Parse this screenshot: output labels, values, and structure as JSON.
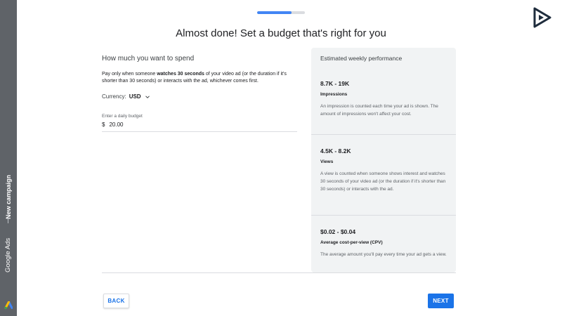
{
  "sidebar": {
    "brand": "Google Ads",
    "campaign": "New campaign"
  },
  "progress": {
    "fraction": 0.72
  },
  "title": "Almost done! Set a budget that's right for you",
  "spend": {
    "heading": "How much you want to spend",
    "desc_before": "Pay only when someone ",
    "desc_bold": "watches 30 seconds",
    "desc_after": " of your video ad (or the duration if it's shorter than 30 seconds) or interacts with the ad, whichever comes first.",
    "currency_label": "Currency:",
    "currency_value": "USD",
    "budget_label": "Enter a daily budget",
    "budget_symbol": "$",
    "budget_value": "20.00"
  },
  "performance": {
    "heading": "Estimated weekly performance",
    "metrics": [
      {
        "range": "8.7K - 19K",
        "name": "Impressions",
        "desc": "An impression is counted each time your ad is shown. The amount of impressions won't affect your cost."
      },
      {
        "range": "4.5K - 8.2K",
        "name": "Views",
        "desc": "A view is counted when someone shows interest and watches 30 seconds of your video ad (or the duration if it's shorter than 30 seconds) or interacts with the ad."
      },
      {
        "range": "$0.02 - $0.04",
        "name": "Average cost-per-view (CPV)",
        "desc": "The average amount you'll pay every time your ad gets a view."
      }
    ]
  },
  "buttons": {
    "back": "BACK",
    "next": "NEXT"
  },
  "colors": {
    "accent": "#1a73e8",
    "sidebar": "#5f6368",
    "panel": "#f1f3f4"
  },
  "icons": {
    "corner": "play-logo-icon",
    "currency": "chevron-down-icon",
    "brand": "google-ads-logo-icon"
  }
}
